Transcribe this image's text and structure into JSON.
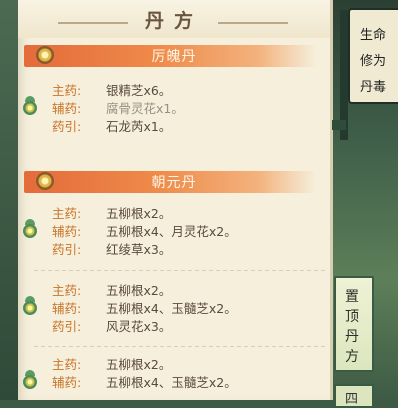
{
  "panel": {
    "title": "丹方"
  },
  "recipes": [
    {
      "name": "厉魄丹",
      "rows": [
        {
          "key": "主药:",
          "value": "银精芝x6。"
        },
        {
          "key": "辅药:",
          "value": "腐骨灵花x1。"
        },
        {
          "key": "药引:",
          "value": "石龙芮x1。"
        }
      ]
    },
    {
      "name": "朝元丹",
      "rows": [
        {
          "key": "主药:",
          "value": "五柳根x2。"
        },
        {
          "key": "辅药:",
          "value": "五柳根x4、月灵花x2。"
        },
        {
          "key": "药引:",
          "value": "红绫草x3。"
        }
      ],
      "rows2": [
        {
          "key": "主药:",
          "value": "五柳根x2。"
        },
        {
          "key": "辅药:",
          "value": "五柳根x4、玉髓芝x2。"
        },
        {
          "key": "药引:",
          "value": "风灵花x3。"
        }
      ],
      "rows3": [
        {
          "key": "主药:",
          "value": "五柳根x2。"
        },
        {
          "key": "辅药:",
          "value": "五柳根x4、玉髓芝x2。"
        }
      ]
    }
  ],
  "status": {
    "line1": "生命",
    "line2": "修为",
    "line3": "丹毒"
  },
  "side_button": {
    "chars": [
      "置",
      "顶",
      "丹",
      "方"
    ]
  },
  "side_button2": {
    "label": "四"
  },
  "icons": {
    "gem": "gem-icon",
    "herb": "herb-icon"
  }
}
